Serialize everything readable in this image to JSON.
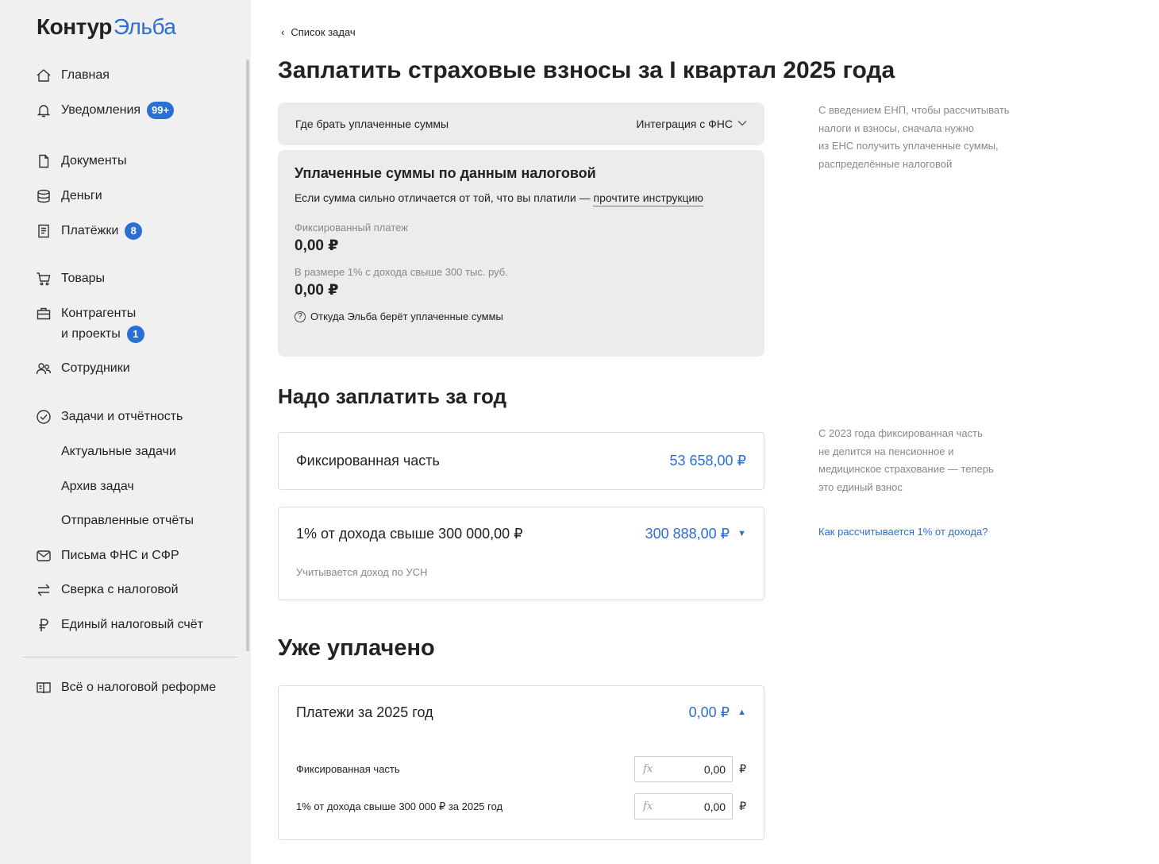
{
  "logo": {
    "part1": "Контур",
    "part2": "Эльба"
  },
  "sidebar": {
    "items": [
      {
        "label": "Главная",
        "icon": "home-icon"
      },
      {
        "label": "Уведомления",
        "icon": "bell-icon",
        "badge": "99+"
      },
      {
        "label": "Документы",
        "icon": "document-icon"
      },
      {
        "label": "Деньги",
        "icon": "coins-icon"
      },
      {
        "label": "Платёжки",
        "icon": "receipt-icon",
        "badge": "8"
      },
      {
        "label": "Товары",
        "icon": "cart-icon"
      },
      {
        "label": "Контрагенты",
        "label2": "и проекты",
        "icon": "briefcase-icon",
        "badge": "1"
      },
      {
        "label": "Сотрудники",
        "icon": "people-icon"
      },
      {
        "label": "Задачи и отчётность",
        "icon": "check-circle-icon"
      },
      {
        "label": "Письма ФНС и СФР",
        "icon": "mail-icon"
      },
      {
        "label": "Сверка с налоговой",
        "icon": "swap-icon"
      },
      {
        "label": "Единый налоговый счёт",
        "icon": "ruble-icon"
      },
      {
        "label": "Всё о налоговой реформе",
        "icon": "book-icon"
      }
    ],
    "subitems": [
      "Актуальные задачи",
      "Архив задач",
      "Отправленные отчёты"
    ]
  },
  "main": {
    "back_label": "Список задач",
    "title": "Заплатить страховые взносы за I квартал 2025 года",
    "source": {
      "label": "Где брать уплаченные суммы",
      "value": "Интеграция с ФНС"
    },
    "paid_box": {
      "title": "Уплаченные суммы по данным налоговой",
      "hint": "Если сумма сильно отличается от той, что вы платили — ",
      "hint_link": "прочтите инструкцию",
      "fixed_label": "Фиксированный платеж",
      "fixed_amount": "0,00 ₽",
      "percent_label": "В размере 1% с дохода свыше 300 тыс. руб.",
      "percent_amount": "0,00 ₽",
      "where_label": "Откуда Эльба берёт уплаченные суммы"
    },
    "aside1": [
      "С введением ЕНП, чтобы рассчитывать",
      "налоги и взносы, сначала нужно",
      "из ЕНС получить уплаченные суммы,",
      "распределённые налоговой"
    ],
    "section_year": "Надо заплатить за год",
    "fixed_part": {
      "label": "Фиксированная часть",
      "value": "53 658,00 ₽"
    },
    "percent_part": {
      "label": "1% от дохода свыше 300 000,00 ₽",
      "value": "300 888,00 ₽",
      "note": "Учитывается доход по УСН"
    },
    "aside2": [
      "С 2023 года фиксированная часть",
      "не делится на пенсионное и",
      "медицинское страхование — теперь",
      "это единый взнос"
    ],
    "aside_link": "Как рассчитывается 1% от дохода?",
    "section_paid": "Уже уплачено",
    "payments": {
      "label": "Платежи за 2025 год",
      "value": "0,00 ₽",
      "rows": [
        {
          "label": "Фиксированная часть",
          "value": "0,00",
          "currency": "₽"
        },
        {
          "label": "1% от дохода свыше 300 000 ₽ за 2025 год",
          "value": "0,00",
          "currency": "₽"
        }
      ]
    }
  },
  "colors": {
    "accent": "#2c6fd4",
    "sidebar_bg": "#f0f0f0",
    "panel_bg": "#ececec"
  }
}
